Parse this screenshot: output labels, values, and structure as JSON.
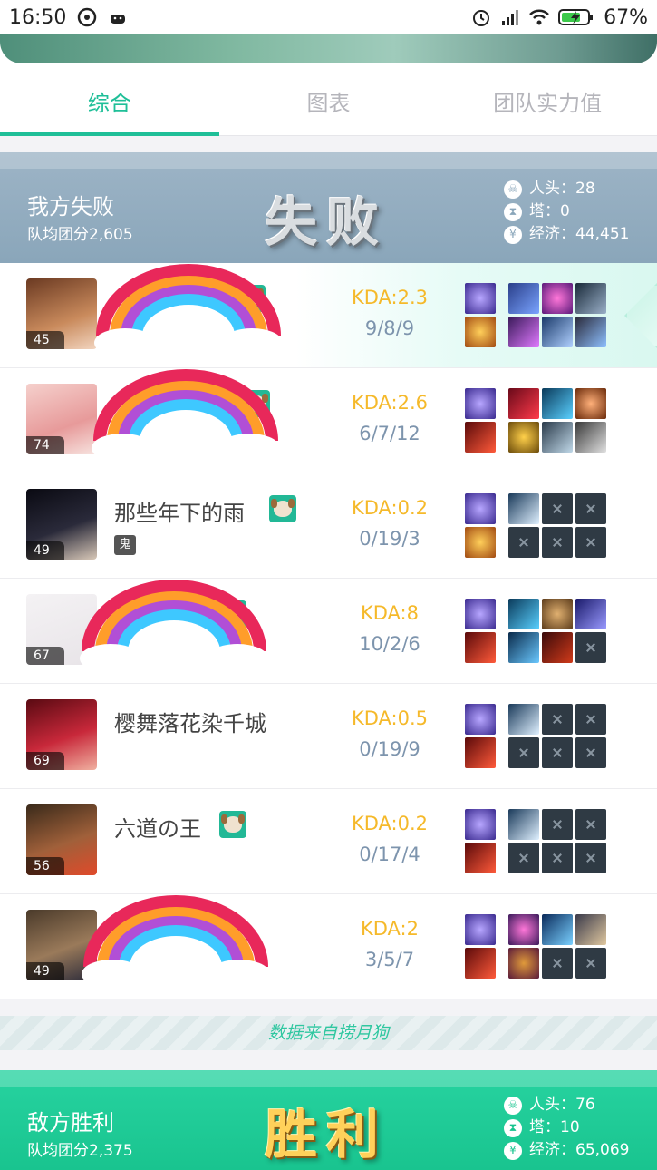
{
  "status_bar": {
    "time": "16:50",
    "battery": "67%"
  },
  "tabs": [
    {
      "label": "综合",
      "active": true
    },
    {
      "label": "图表",
      "active": false
    },
    {
      "label": "团队实力值",
      "active": false
    }
  ],
  "our_team": {
    "title": "我方失败",
    "sub": "队均团分2,605",
    "result": "失败",
    "stats": {
      "kills": "人头：28",
      "towers": "塔：0",
      "economy": "经济：44,451"
    }
  },
  "enemy_team": {
    "title": "敌方胜利",
    "sub": "队均团分2,375",
    "result": "胜利",
    "stats": {
      "kills": "人头：76",
      "towers": "塔：10",
      "economy": "经济：65,069"
    }
  },
  "players": [
    {
      "level": "45",
      "name": "",
      "kda": "KDA:2.3",
      "kills": "9/8/9",
      "mvp": true,
      "items_filled": 6
    },
    {
      "level": "74",
      "name": "",
      "kda": "KDA:2.6",
      "kills": "6/7/12",
      "mvp": false,
      "items_filled": 6
    },
    {
      "level": "49",
      "name": "那些年下的雨",
      "tag": "鬼",
      "kda": "KDA:0.2",
      "kills": "0/19/3",
      "mvp": false,
      "items_filled": 1
    },
    {
      "level": "67",
      "name": "",
      "kda": "KDA:8",
      "kills": "10/2/6",
      "mvp": false,
      "items_filled": 5
    },
    {
      "level": "69",
      "name": "樱舞落花染千城",
      "kda": "KDA:0.5",
      "kills": "0/19/9",
      "mvp": false,
      "items_filled": 1
    },
    {
      "level": "56",
      "name": "六道の王",
      "kda": "KDA:0.2",
      "kills": "0/17/4",
      "mvp": false,
      "items_filled": 1
    },
    {
      "level": "49",
      "name": "",
      "kda": "KDA:2",
      "kills": "3/5/7",
      "mvp": false,
      "items_filled": 4
    }
  ],
  "source_text": "数据来自捞月狗",
  "colors": {
    "accent": "#1fbf98",
    "kda": "#f5b92a",
    "lose": "#8aa6ba",
    "win": "#19c48f"
  }
}
